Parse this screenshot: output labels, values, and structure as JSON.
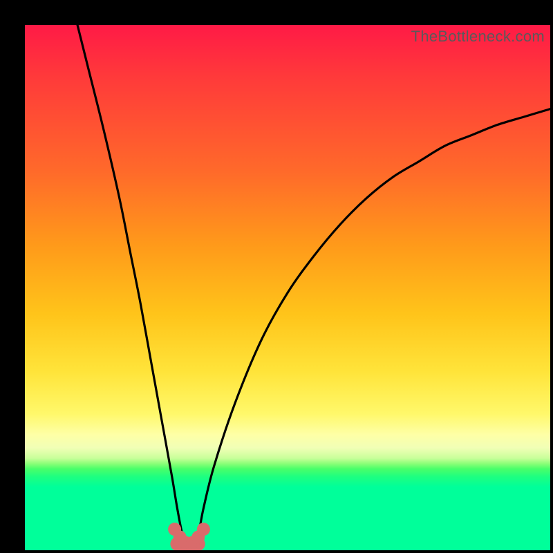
{
  "watermark": "TheBottleneck.com",
  "chart_data": {
    "type": "line",
    "title": "",
    "xlabel": "",
    "ylabel": "",
    "xlim": [
      0,
      100
    ],
    "ylim": [
      0,
      100
    ],
    "series": [
      {
        "name": "bottleneck-curve",
        "x": [
          10,
          12,
          15,
          18,
          20,
          22,
          24,
          26,
          28,
          29,
          30,
          31,
          32,
          33,
          34,
          36,
          40,
          45,
          50,
          55,
          60,
          65,
          70,
          75,
          80,
          85,
          90,
          95,
          100
        ],
        "y": [
          100,
          92,
          80,
          67,
          57,
          47,
          36,
          25,
          14,
          8,
          3,
          1,
          1,
          3,
          8,
          16,
          28,
          40,
          49,
          56,
          62,
          67,
          71,
          74,
          77,
          79,
          81,
          82.5,
          84
        ]
      },
      {
        "name": "marker-dots",
        "x": [
          28.5,
          29.5,
          30.5,
          32.0,
          33.0,
          34.0
        ],
        "y": [
          4.0,
          2.5,
          1.5,
          1.5,
          2.5,
          4.0
        ]
      },
      {
        "name": "marker-strip",
        "x": [
          29,
          30,
          31,
          32,
          33
        ],
        "y": [
          1.2,
          0.6,
          0.4,
          0.6,
          1.2
        ]
      }
    ],
    "colors": {
      "curve": "#000000",
      "marker_dot": "#d96b6b",
      "marker_strip": "#d96b6b"
    }
  }
}
